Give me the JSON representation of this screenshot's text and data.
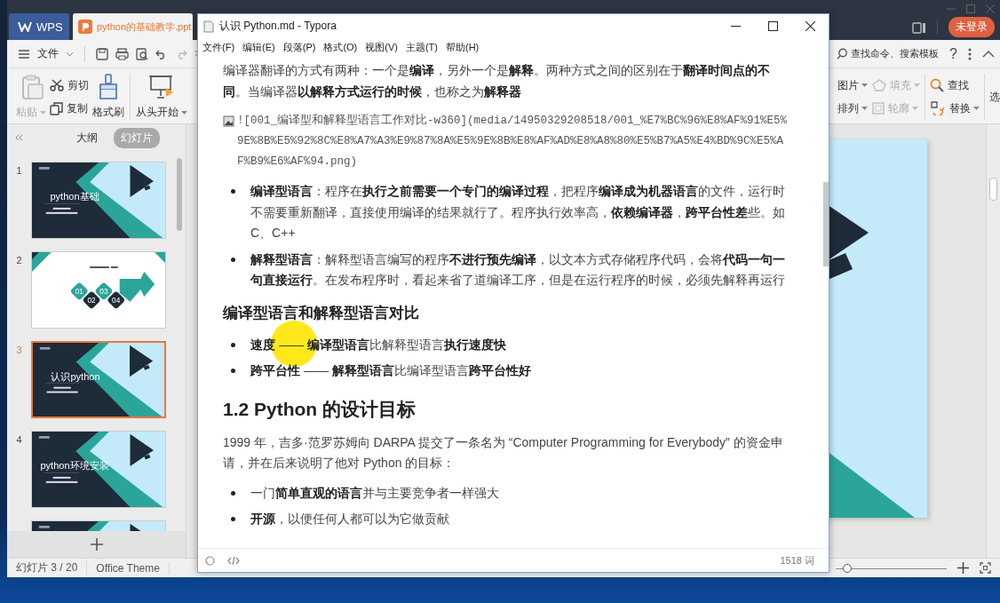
{
  "wps": {
    "tabs": [
      {
        "label": "WPS",
        "kind": "home",
        "selected": false
      },
      {
        "label": "python的基础教学.ppt",
        "kind": "document",
        "selected": true
      }
    ],
    "account_button": "未登录",
    "file_menu": "文件",
    "command_search": {
      "placeholder": "查找命令、搜索模板"
    },
    "help_button": "?",
    "ribbon_left": [
      {
        "label": "粘贴",
        "kind": "paste",
        "disabled": true,
        "has_menu": true
      },
      {
        "label": "剪切",
        "kind": "cut",
        "disabled": false,
        "has_menu": false
      },
      {
        "label": "复制",
        "kind": "copy",
        "disabled": false,
        "has_menu": false
      },
      {
        "label": "格式刷",
        "kind": "brush",
        "disabled": false,
        "has_menu": false
      },
      {
        "label": "从头开始",
        "kind": "slideshow",
        "disabled": false,
        "has_menu": true
      }
    ],
    "ribbon_right": [
      {
        "label": "图片",
        "kind": "hidden-icon",
        "disabled": false,
        "has_menu": true
      },
      {
        "label": "排列",
        "kind": "hidden-icon",
        "disabled": false,
        "has_menu": true
      },
      {
        "label": "填充",
        "kind": "fill",
        "disabled": true,
        "has_menu": true
      },
      {
        "label": "轮廓",
        "kind": "outline",
        "disabled": true,
        "has_menu": true
      },
      {
        "label": "查找",
        "kind": "find",
        "disabled": false,
        "has_menu": false
      },
      {
        "label": "替换",
        "kind": "replace",
        "disabled": false,
        "has_menu": true
      },
      {
        "label": "选",
        "kind": "hidden-icon",
        "disabled": false,
        "has_menu": false
      }
    ],
    "panel_tabs": [
      {
        "label": "大纲",
        "selected": false
      },
      {
        "label": "幻灯片",
        "selected": true
      }
    ],
    "slides": [
      {
        "number": "1",
        "kind": "cover",
        "title": "python基础",
        "selected": false
      },
      {
        "number": "2",
        "kind": "agenda",
        "steps": [
          "01",
          "02",
          "03",
          "04"
        ],
        "selected": false
      },
      {
        "number": "3",
        "kind": "cover",
        "title": "认识python",
        "selected": true
      },
      {
        "number": "4",
        "kind": "cover",
        "title": "python环境安装",
        "selected": false
      },
      {
        "kind": "cover",
        "selected": false
      }
    ],
    "status_bar": {
      "slide_counter": "幻灯片 3 / 20",
      "theme": "Office Theme"
    },
    "zoom": {
      "level": 0.1
    }
  },
  "typora": {
    "title": "认识 Python.md - Typora",
    "menu": [
      "文件(F)",
      "编辑(E)",
      "段落(P)",
      "格式(O)",
      "视图(V)",
      "主题(T)",
      "帮助(H)"
    ],
    "blocks": [
      {
        "kind": "paragraph",
        "text": "编译器翻译的方式有两种：一个是**编译**，另外一个是**解释**。两种方式之间的区别在于**翻译时间点的不同**。当编译器**以解释方式运行的时候**，也称之为**解释器**"
      },
      {
        "kind": "image-link",
        "text": "![001_编译型和解释型语言工作对比-w360](media/14950329208518/001_%E7%BC%96%E8%AF%91%E5%9E%8B%E5%92%8C%E8%A7%A3%E9%87%8A%E5%9E%8B%E8%AF%AD%E8%A8%80%E5%B7%A5%E4%BD%9C%E5%AF%B9%E6%AF%94.png)"
      },
      {
        "kind": "bullets",
        "items": [
          "**编译型语言**：程序在**执行之前需要一个专门的编译过程**，把程序**编译成为机器语言**的文件，运行时不需要重新翻译，直接使用编译的结果就行了。程序执行效率高，**依赖编译器**，**跨平台性差**些。如 C、C++",
          "**解释型语言**：解释型语言编写的程序**不进行预先编译**，以文本方式存储程序代码，会将**代码一句一句直接运行**。在发布程序时，看起来省了道编译工序，但是在运行程序的时候，必须先解释再运行"
        ]
      },
      {
        "kind": "heading3",
        "text": "编译型语言和解释型语言对比"
      },
      {
        "kind": "bullets",
        "items": [
          "**速度** —— **编译型语言**比解释型语言**执行速度快**",
          "**跨平台性** —— **解释型语言**比编译型语言**跨平台性好**"
        ]
      },
      {
        "kind": "heading2",
        "text": "1.2 Python 的设计目标"
      },
      {
        "kind": "paragraph",
        "text": "1999 年，吉多·范罗苏姆向 DARPA 提交了一条名为 “Computer Programming for Everybody” 的资金申请，并在后来说明了他对 Python 的目标："
      },
      {
        "kind": "bullets",
        "items": [
          "一门**简单直观的语言**并与主要竞争者一样强大",
          "**开源**，以便任何人都可以为它做贡献"
        ]
      }
    ],
    "word_count": "1518 词"
  }
}
